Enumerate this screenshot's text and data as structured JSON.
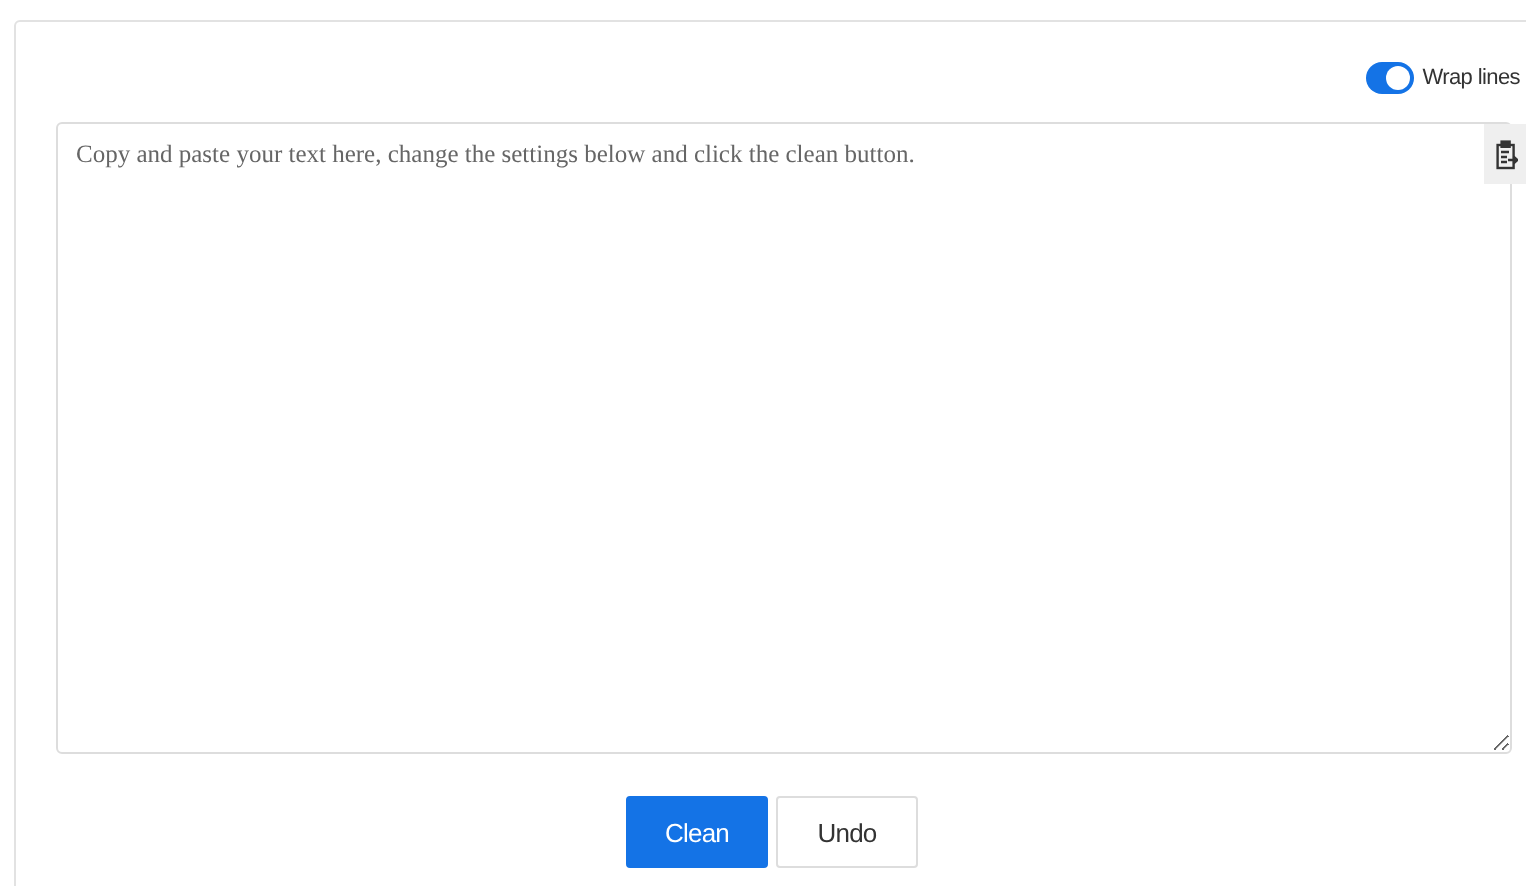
{
  "wrap_toggle": {
    "label": "Wrap lines",
    "on": true
  },
  "editor": {
    "placeholder": "Copy and paste your text here, change the settings below and click the clean button."
  },
  "buttons": [
    {
      "label": "Clean",
      "kind": "primary"
    },
    {
      "label": "Undo",
      "kind": "secondary"
    }
  ]
}
